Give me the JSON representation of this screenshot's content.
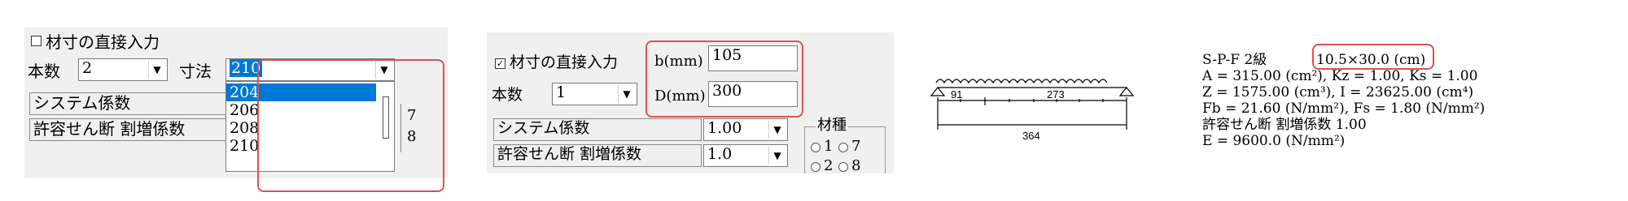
{
  "panel1": {
    "direct_input_label": "材寸の直接入力",
    "count_label": "本数",
    "count_value": "2",
    "size_label": "寸法",
    "size_value": "210",
    "system_coeff_label": "システム係数",
    "shear_coeff_label": "許容せん断 割増係数",
    "size_options": [
      "204",
      "206",
      "208",
      "210"
    ],
    "side_numbers": [
      "7",
      "8"
    ]
  },
  "panel2": {
    "direct_input_label": "材寸の直接入力",
    "b_label": "b(mm)",
    "b_value": "105",
    "d_label": "D(mm)",
    "d_value": "300",
    "count_label": "本数",
    "count_value": "1",
    "system_coeff_label": "システム係数",
    "system_coeff_value": "1.00",
    "shear_coeff_label": "許容せん断 割増係数",
    "shear_coeff_value": "1.0",
    "material_label": "材種",
    "material_options": [
      "1",
      "7",
      "2",
      "8"
    ]
  },
  "beam": {
    "dim_left": "91",
    "dim_right": "273",
    "dim_total": "364"
  },
  "result": {
    "grade_line": "S-P-F 2級",
    "section": "10.5×30.0 (cm)",
    "line_a": "A = 315.00 (cm²),  Kz = 1.00,  Ks = 1.00",
    "line_z": "Z = 1575.00 (cm³),  I = 23625.00 (cm⁴)",
    "line_fb": "Fb = 21.60 (N/mm²),  Fs = 1.80 (N/mm²)",
    "line_shear": "許容せん断 割増係数  1.00",
    "line_e": "E = 9600.0 (N/mm²)"
  }
}
